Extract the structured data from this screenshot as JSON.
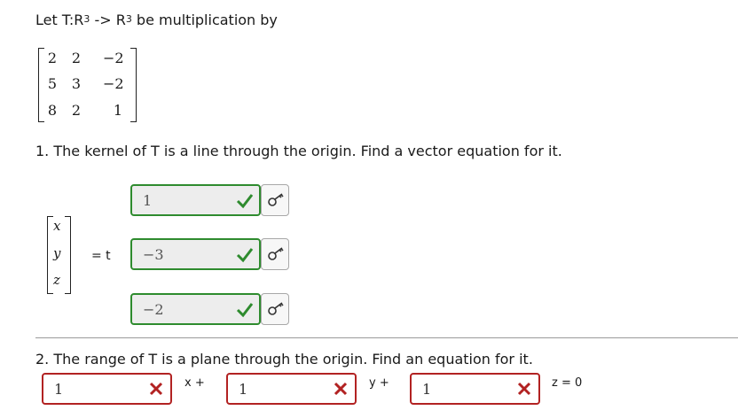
{
  "intro": {
    "prefix": "Let T:R",
    "exp1": "3",
    "arrow": " -> R",
    "exp2": "3",
    "suffix": " be multiplication by"
  },
  "matrix": [
    [
      "2",
      "2",
      "−2"
    ],
    [
      "5",
      "3",
      "−2"
    ],
    [
      "8",
      "2",
      "1"
    ]
  ],
  "q1": {
    "text": "1. The kernel of T is a line through the origin. Find a vector equation for it.",
    "vector": [
      "x",
      "y",
      "z"
    ],
    "equals_t": "= t",
    "answers": [
      {
        "value": "1",
        "status": "correct"
      },
      {
        "value": "−3",
        "status": "correct"
      },
      {
        "value": "−2",
        "status": "correct"
      }
    ]
  },
  "q2": {
    "text": "2. The range of T is a plane through the origin. Find an equation for it.",
    "answers": [
      {
        "value": "1",
        "status": "incorrect",
        "suffix": "x +"
      },
      {
        "value": "1",
        "status": "incorrect",
        "suffix": "y +"
      },
      {
        "value": "1",
        "status": "incorrect",
        "suffix": "z = 0"
      }
    ]
  },
  "colors": {
    "correct": "#2e8b2e",
    "incorrect": "#b22222"
  },
  "icons": {
    "check": "check-icon",
    "cross": "cross-icon",
    "key": "key-icon"
  }
}
